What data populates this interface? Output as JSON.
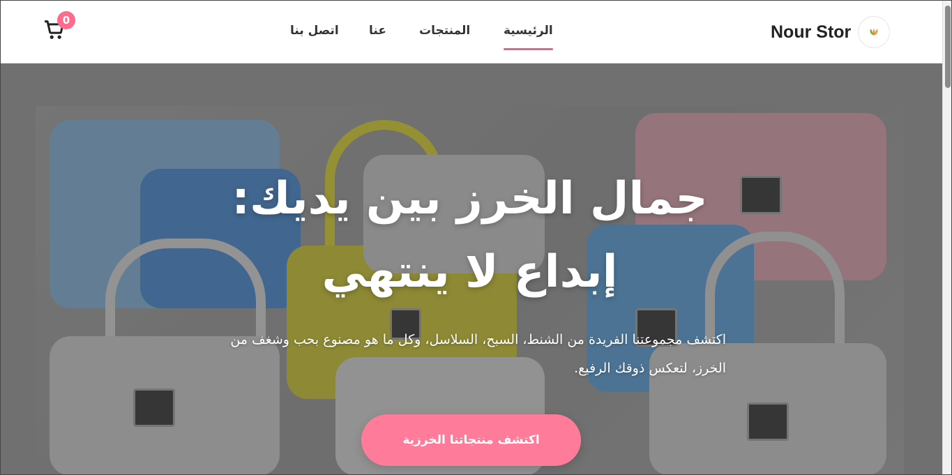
{
  "header": {
    "brand_name": "Nour Stor",
    "cart_count": "0",
    "nav": [
      {
        "label": "الرئيسية",
        "active": true
      },
      {
        "label": "المنتجات",
        "active": false
      },
      {
        "label": "عنا",
        "active": false
      },
      {
        "label": "اتصل بنا",
        "active": false
      }
    ]
  },
  "hero": {
    "title_line1": "جمال الخرز بين يديك:",
    "title_line2": "إبداع لا ينتهي",
    "subtitle": "اكتشف مجموعتنا الفريدة من الشنط، السبح، السلاسل، وكل ما هو مصنوع بحب وشغف من الخرز، لتعكس ذوقك الرفيع.",
    "cta_label": "اكتشف منتجاتنا الخرزية"
  },
  "colors": {
    "accent": "#ff7b9a",
    "nav_underline": "#ef5d86",
    "badge": "#ff6b8b"
  },
  "icons": {
    "cart": "cart-icon",
    "logo": "leaf-logo-icon"
  }
}
